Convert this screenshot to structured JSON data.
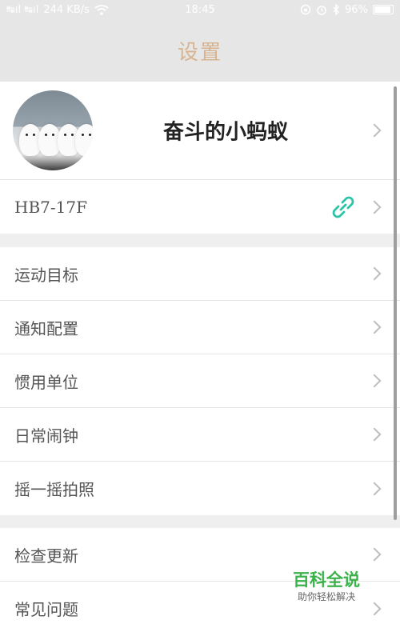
{
  "status_bar": {
    "signal": "↹ıl ↹ıl",
    "network_speed": "244 KB/s",
    "time": "18:45",
    "battery": "96%",
    "icons": [
      "wifi-icon",
      "lock-rotation-icon",
      "alarm-icon",
      "bluetooth-icon",
      "battery-icon"
    ]
  },
  "header": {
    "title": "设置"
  },
  "profile": {
    "name": "奋斗的小蚂蚁"
  },
  "device": {
    "id": "HB7-17F",
    "link_color": "#2cc4a8"
  },
  "group1": {
    "items": [
      {
        "label": "运动目标"
      },
      {
        "label": "通知配置"
      },
      {
        "label": "惯用单位"
      },
      {
        "label": "日常闹钟"
      },
      {
        "label": "摇一摇拍照"
      }
    ]
  },
  "group2": {
    "items": [
      {
        "label": "检查更新"
      },
      {
        "label": "常见问题"
      }
    ]
  },
  "watermark": {
    "title": "百科全说",
    "subtitle": "助你轻松解决"
  },
  "colors": {
    "title": "#d7b48f",
    "background": "#efefef",
    "header_bg": "#e6e6e6"
  }
}
